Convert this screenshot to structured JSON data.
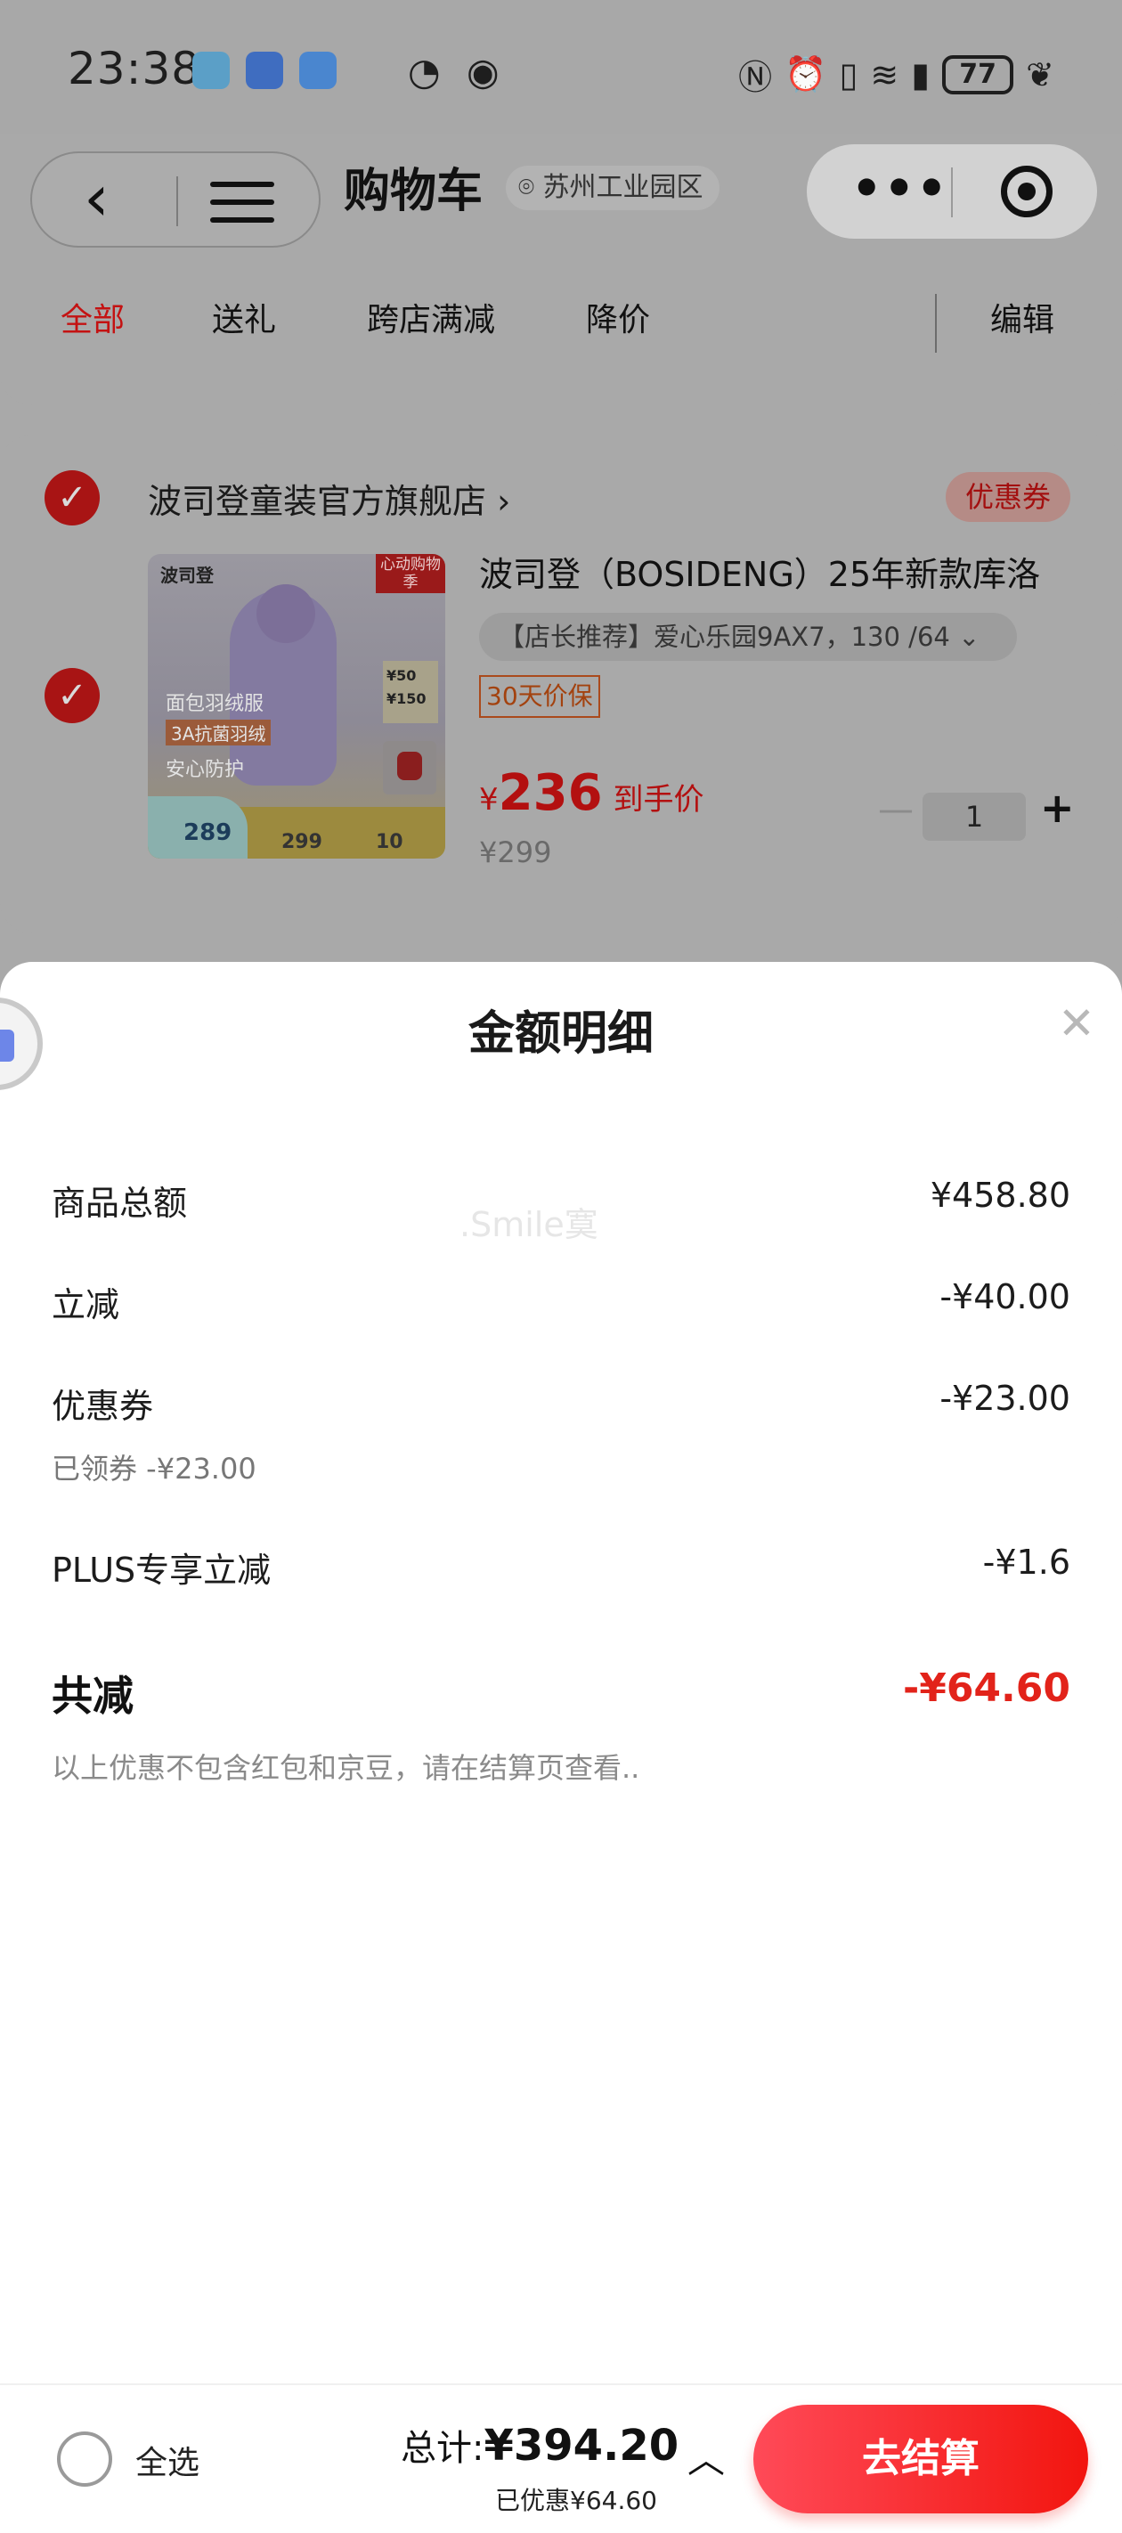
{
  "status_bar": {
    "time": "23:38",
    "battery": "77",
    "icons": [
      "app-icon-1",
      "app-icon-2",
      "app-icon-3",
      "clock-icon",
      "eye-icon",
      "nfc-icon",
      "alarm-icon",
      "vibrate-icon",
      "wifi-6-icon",
      "signal-icon",
      "leaf-icon"
    ]
  },
  "header": {
    "title": "购物车",
    "location": "苏州工业园区",
    "filters": [
      "全部",
      "送礼",
      "跨店满减",
      "降价"
    ],
    "edit": "编辑"
  },
  "cart": {
    "shop_name": "波司登童装官方旗舰店 ›",
    "coupon_tag": "优惠券",
    "product": {
      "title": "波司登（BOSIDENG）25年新款库洛",
      "sku": "【店长推荐】爱心乐园9AX7，130 /64  ⌄",
      "guarantee": "30天价保",
      "price_symbol": "¥",
      "price": "236",
      "price_label": "到手价",
      "original_price": "¥299",
      "quantity": "1",
      "image": {
        "brand": "波司登",
        "promo": "心动购物季",
        "tag1": "面包羽绒服",
        "tag2": "3A抗菌羽绒",
        "tag3": "安心防护",
        "price_a": "289",
        "price_b": "299",
        "price_c": "10",
        "side_50": "¥50",
        "side_150": "¥150"
      }
    }
  },
  "sheet": {
    "title": "金额明细",
    "watermark": ".Smile寞",
    "rows": [
      {
        "label": "商品总额",
        "value": "¥458.80"
      },
      {
        "label": "立减",
        "value": "-¥40.00"
      },
      {
        "label": "优惠券",
        "value": "-¥23.00",
        "sub": "已领券 -¥23.00"
      },
      {
        "label": "PLUS专享立减",
        "value": "-¥1.6"
      }
    ],
    "total_label": "共减",
    "total_value": "-¥64.60",
    "note": "以上优惠不包含红包和京豆，请在结算页查看.."
  },
  "bottom_bar": {
    "select_all": "全选",
    "total_prefix": "总计:",
    "total_amount": "¥394.20",
    "saved": "已优惠¥64.60",
    "checkout": "去结算"
  },
  "colors": {
    "accent_red": "#e2231a",
    "checkout_gradient_start": "#ff4a58",
    "checkout_gradient_end": "#f2150f",
    "overlay_gray": "#a9a9a9"
  }
}
